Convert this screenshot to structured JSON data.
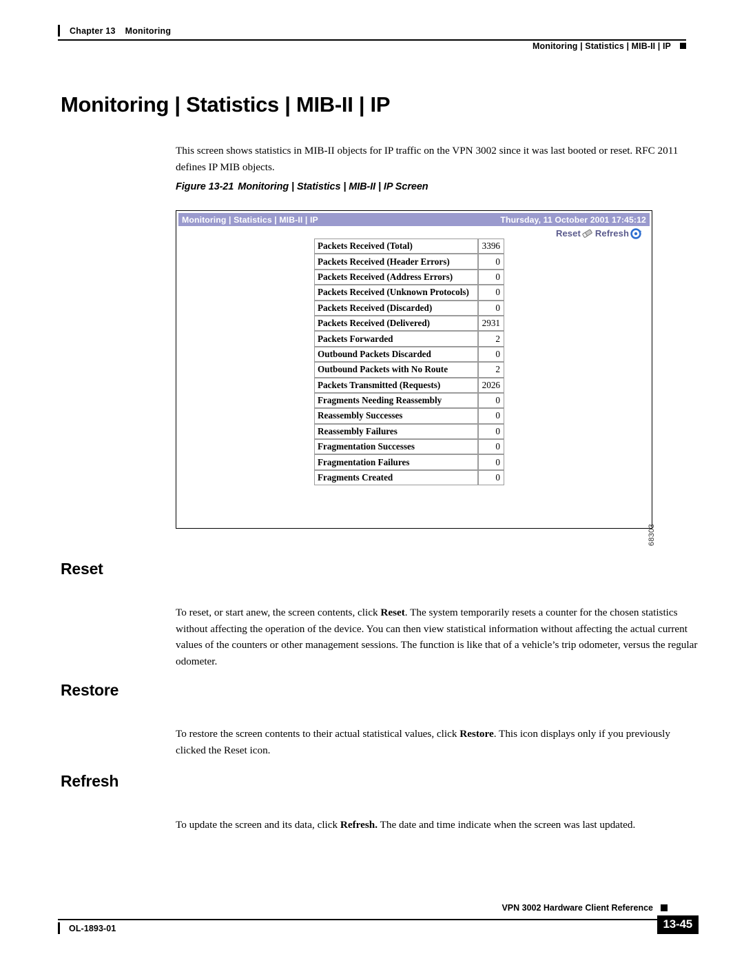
{
  "header": {
    "chapter_label": "Chapter 13",
    "chapter_title": "Monitoring",
    "section_path": "Monitoring | Statistics | MIB-II | IP"
  },
  "page_title": "Monitoring | Statistics | MIB-II | IP",
  "intro_paragraph": "This screen shows statistics in MIB-II objects for IP traffic on the VPN 3002 since it was last booted or reset. RFC 2011 defines IP MIB objects.",
  "figure": {
    "caption_number": "Figure 13-21",
    "caption_text": "Monitoring | Statistics | MIB-II | IP Screen",
    "figure_id": "68303",
    "screenshot": {
      "titlebar_title": "Monitoring | Statistics | MIB-II | IP",
      "titlebar_datetime": "Thursday, 11 October 2001 17:45:12",
      "titlebar_color": "#9a9acd",
      "toolbar": {
        "reset_label": "Reset",
        "reset_icon": "eraser-icon",
        "refresh_label": "Refresh",
        "refresh_icon": "circular-arrow-icon",
        "link_color": "#5a5a8c"
      },
      "stats_rows": [
        {
          "label": "Packets Received (Total)",
          "value": "3396"
        },
        {
          "label": "Packets Received (Header Errors)",
          "value": "0"
        },
        {
          "label": "Packets Received (Address Errors)",
          "value": "0"
        },
        {
          "label": "Packets Received (Unknown Protocols)",
          "value": "0"
        },
        {
          "label": "Packets Received (Discarded)",
          "value": "0"
        },
        {
          "label": "Packets Received (Delivered)",
          "value": "2931"
        },
        {
          "label": "Packets Forwarded",
          "value": "2"
        },
        {
          "label": "Outbound Packets Discarded",
          "value": "0"
        },
        {
          "label": "Outbound Packets with No Route",
          "value": "2"
        },
        {
          "label": "Packets Transmitted (Requests)",
          "value": "2026"
        },
        {
          "label": "Fragments Needing Reassembly",
          "value": "0"
        },
        {
          "label": "Reassembly Successes",
          "value": "0"
        },
        {
          "label": "Reassembly Failures",
          "value": "0"
        },
        {
          "label": "Fragmentation Successes",
          "value": "0"
        },
        {
          "label": "Fragmentation Failures",
          "value": "0"
        },
        {
          "label": "Fragments Created",
          "value": "0"
        }
      ]
    }
  },
  "sections": {
    "reset": {
      "heading": "Reset",
      "paragraph_pre": "To reset, or start anew, the screen contents, click ",
      "paragraph_bold": "Reset",
      "paragraph_post": ". The system temporarily resets a counter for the chosen statistics without affecting the operation of the device. You can then view statistical information without affecting the actual current values of the counters or other management sessions. The function is like that of a vehicle’s trip odometer, versus the regular odometer."
    },
    "restore": {
      "heading": "Restore",
      "paragraph_pre": "To restore the screen contents to their actual statistical values, click ",
      "paragraph_bold": "Restore",
      "paragraph_post": ". This icon displays only if you previously clicked the Reset icon."
    },
    "refresh": {
      "heading": "Refresh",
      "paragraph_pre": "To update the screen and its data, click ",
      "paragraph_bold": "Refresh.",
      "paragraph_post": " The date and time indicate when the screen was last updated."
    }
  },
  "footer": {
    "book_title": "VPN 3002 Hardware Client Reference",
    "doc_id": "OL-1893-01",
    "page_number": "13-45"
  }
}
